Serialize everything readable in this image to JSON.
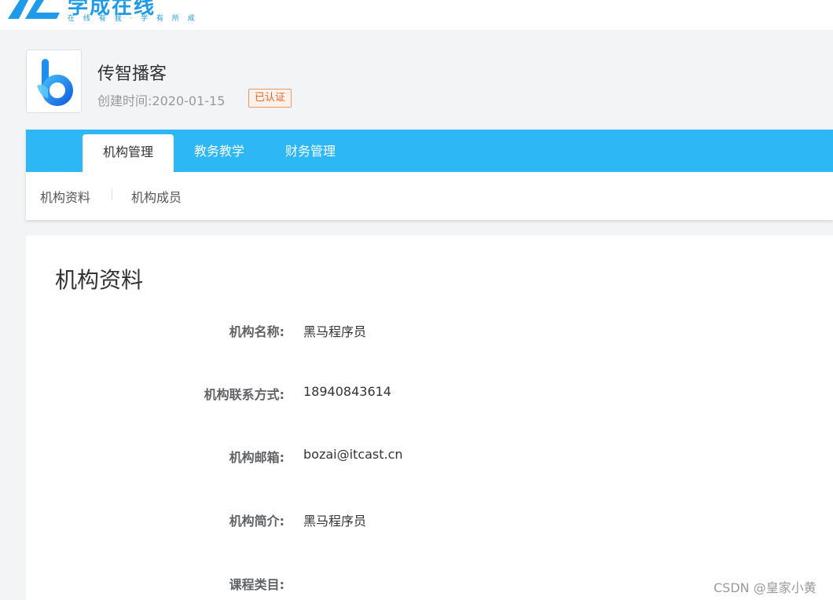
{
  "header": {
    "brand_name": "学成在线",
    "brand_slogan": "在 线 有 我 · 学 有 所 成"
  },
  "organization": {
    "name": "传智播客",
    "created_label": "创建时间:",
    "created_date": "2020-01-15",
    "cert_badge": "已认证"
  },
  "nav": {
    "main_tabs": [
      {
        "label": "机构管理",
        "active": true
      },
      {
        "label": "教务教学",
        "active": false
      },
      {
        "label": "财务管理",
        "active": false
      }
    ],
    "sub_tabs": [
      {
        "label": "机构资料"
      },
      {
        "label": "机构成员"
      }
    ]
  },
  "content": {
    "title": "机构资料",
    "fields": [
      {
        "label": "机构名称:",
        "value": "黑马程序员"
      },
      {
        "label": "机构联系方式:",
        "value": "18940843614"
      },
      {
        "label": "机构邮箱:",
        "value": "bozai@itcast.cn"
      },
      {
        "label": "机构简介:",
        "value": "黑马程序员"
      },
      {
        "label": "课程类目:",
        "value": ""
      }
    ]
  },
  "watermark": "CSDN @皇家小黄",
  "colors": {
    "brand_blue": "#1e9be8",
    "nav_blue": "#2db7f5",
    "badge_orange": "#e8682b",
    "page_bg": "#f3f4f6"
  }
}
